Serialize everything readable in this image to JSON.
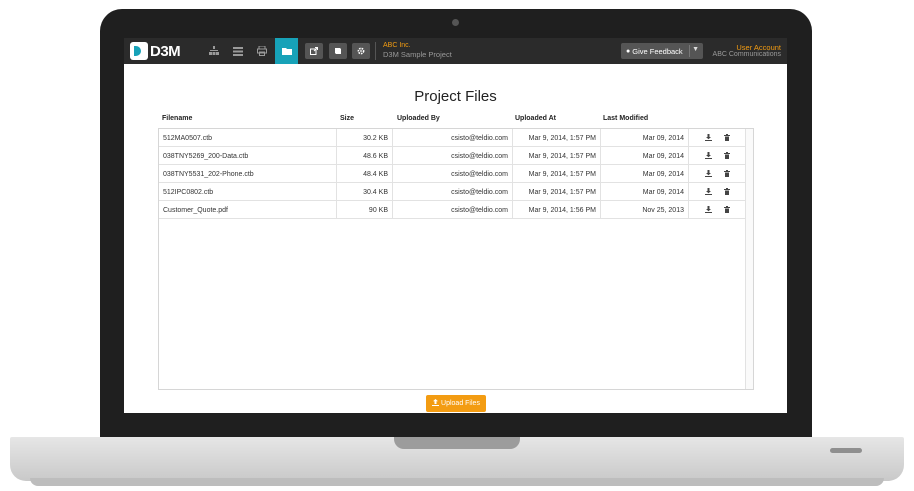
{
  "nav": {
    "logo_text": "D3M",
    "org_name": "ABC Inc.",
    "project_name": "D3M Sample Project",
    "feedback_label": "Give Feedback",
    "account_label": "User Account",
    "account_name": "ABC Communications",
    "icons": [
      "sitemap-icon",
      "list-icon",
      "print-icon",
      "folder-icon",
      "export-icon",
      "book-icon",
      "gear-icon"
    ]
  },
  "page": {
    "title": "Project Files",
    "upload_label": "Upload Files"
  },
  "table": {
    "columns": [
      "Filename",
      "Size",
      "Uploaded By",
      "Uploaded At",
      "Last Modified"
    ],
    "rows": [
      {
        "filename": "512MA0507.ctb",
        "size": "30.2 KB",
        "uploaded_by": "csisto@teldio.com",
        "uploaded_at": "Mar 9, 2014, 1:57 PM",
        "last_modified": "Mar 09, 2014"
      },
      {
        "filename": "038TNY5269_200-Data.ctb",
        "size": "48.6 KB",
        "uploaded_by": "csisto@teldio.com",
        "uploaded_at": "Mar 9, 2014, 1:57 PM",
        "last_modified": "Mar 09, 2014"
      },
      {
        "filename": "038TNY5531_202-Phone.ctb",
        "size": "48.4 KB",
        "uploaded_by": "csisto@teldio.com",
        "uploaded_at": "Mar 9, 2014, 1:57 PM",
        "last_modified": "Mar 09, 2014"
      },
      {
        "filename": "512IPC0802.ctb",
        "size": "30.4 KB",
        "uploaded_by": "csisto@teldio.com",
        "uploaded_at": "Mar 9, 2014, 1:57 PM",
        "last_modified": "Mar 09, 2014"
      },
      {
        "filename": "Customer_Quote.pdf",
        "size": "90 KB",
        "uploaded_by": "csisto@teldio.com",
        "uploaded_at": "Mar 9, 2014, 1:56 PM",
        "last_modified": "Nov 25, 2013"
      }
    ]
  },
  "colors": {
    "accent_teal": "#17a2b8",
    "accent_orange": "#f39c12",
    "nav_bg": "#2b2b2b"
  }
}
